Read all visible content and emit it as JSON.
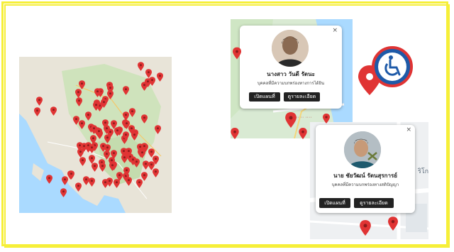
{
  "overview_map": {
    "label": "province-map-with-markers"
  },
  "popup_1": {
    "name": "นางสาว วันดี รัตนะ",
    "description": "บุคคลที่มีความบกพร่องทางการได้ยิน",
    "buttons": {
      "open_map": "เปิดแผนที่",
      "details": "ดูรายละเอียด"
    },
    "close": "×"
  },
  "popup_2": {
    "name": "นาย ชัยวัฒน์ รัตนสุรการย์",
    "description": "บุคคลที่มีความบกพร่องทางสติปัญญา",
    "buttons": {
      "open_map": "เปิดแผนที่",
      "details": "ดูรายละเอียด"
    },
    "close": "×"
  },
  "map_labels": {
    "road_label": "ริโก"
  },
  "colors": {
    "frame": "#f6ef38",
    "pin": "#e03434",
    "accessibility_blue": "#1e5aa8"
  },
  "icons": {
    "accessibility": "wheelchair-icon",
    "location": "map-pin-icon"
  }
}
